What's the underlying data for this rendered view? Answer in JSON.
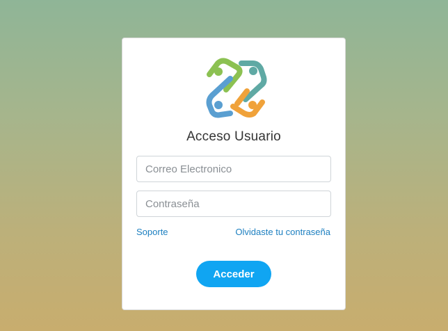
{
  "login": {
    "title": "Acceso Usuario",
    "email_placeholder": "Correo Electronico",
    "password_placeholder": "Contraseña",
    "support_link": "Soporte",
    "forgot_link": "Olvidaste tu contraseña",
    "submit_label": "Acceder"
  },
  "logo": {
    "icon": "people-circle-logo-icon",
    "colors": {
      "green": "#8cc152",
      "teal": "#5fa9a4",
      "blue": "#5a9fd1",
      "orange": "#f0a23a"
    }
  },
  "colors": {
    "link": "#1c7fc0",
    "button": "#10a5f2",
    "card": "#ffffff"
  }
}
